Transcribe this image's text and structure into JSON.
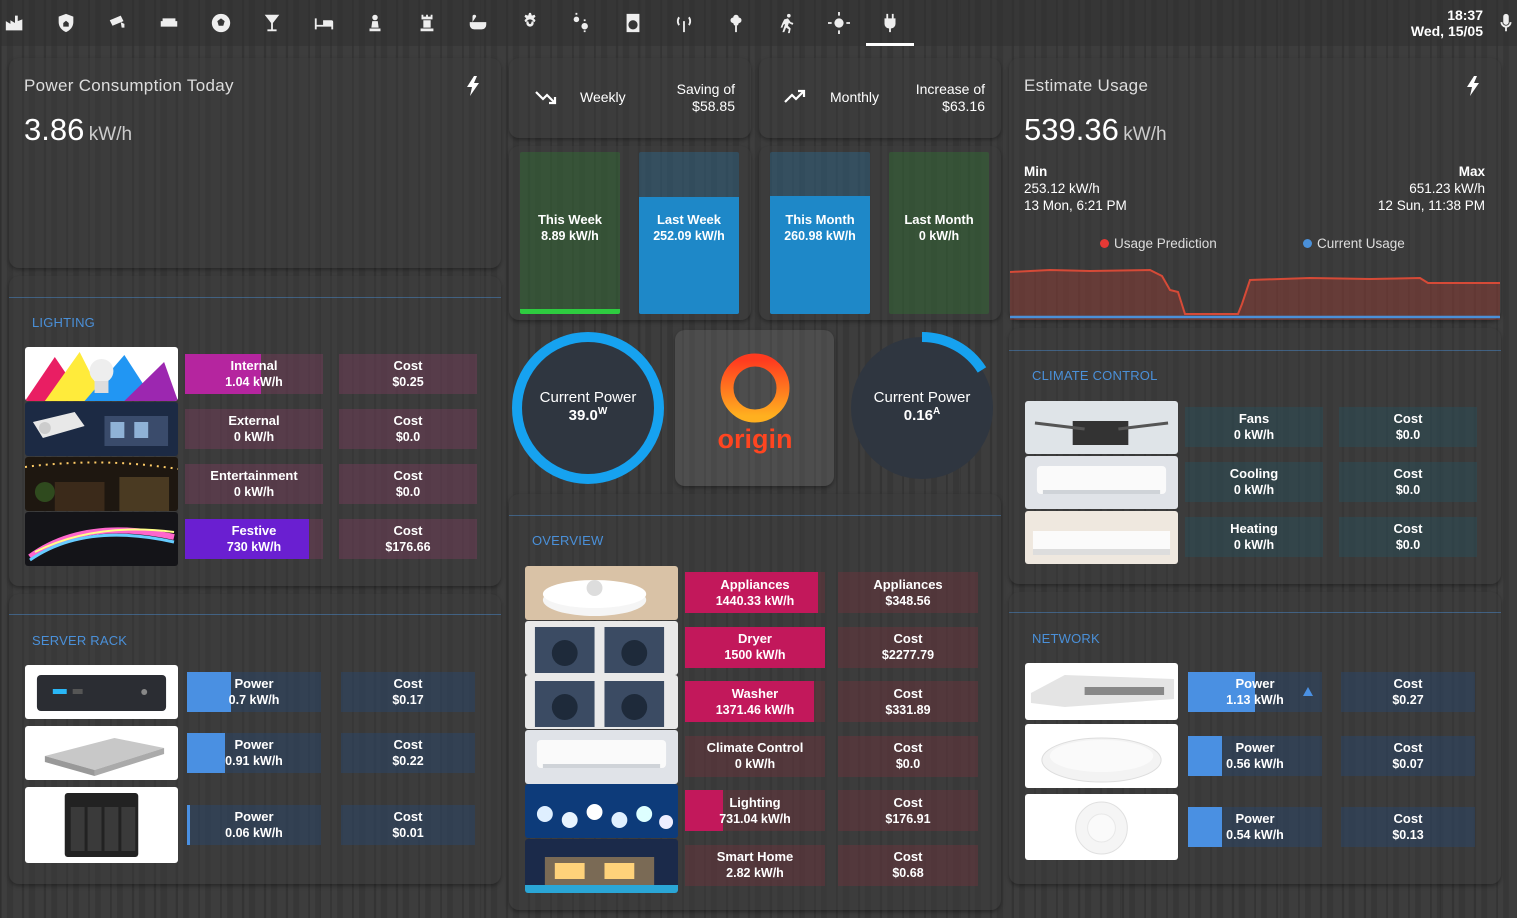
{
  "clock": {
    "time": "18:37",
    "date": "Wed, 15/05"
  },
  "nav": [
    "factory-icon",
    "shield-home-icon",
    "cctv-icon",
    "sofa-icon",
    "soccer-icon",
    "glass-cocktail-icon",
    "bed-icon",
    "chess-pawn-icon",
    "chess-rook-icon",
    "bathtub-icon",
    "gear-icon",
    "gears-icon",
    "washing-machine-icon",
    "antenna-icon",
    "flower-icon",
    "run-icon",
    "sun-icon",
    "power-plug-icon",
    "microphone-icon"
  ],
  "power_today": {
    "title": "Power Consumption Today",
    "value": "3.86",
    "unit": "kW/h"
  },
  "weekly": {
    "label": "Weekly",
    "line1": "Saving of",
    "line2": "$58.85"
  },
  "monthly": {
    "label": "Monthly",
    "line1": "Increase of",
    "line2": "$63.16"
  },
  "bars": [
    {
      "label": "This Week",
      "value": "8.89 kW/h",
      "fill": 0.03,
      "color": "#2e7d32"
    },
    {
      "label": "Last Week",
      "value": "252.09 kW/h",
      "fill": 0.72,
      "color": "#1e88c8"
    },
    {
      "label": "This Month",
      "value": "260.98 kW/h",
      "fill": 0.73,
      "color": "#1e88c8"
    },
    {
      "label": "Last Month",
      "value": "0 kW/h",
      "fill": 0,
      "color": "#2e7d32"
    }
  ],
  "estimate": {
    "title": "Estimate Usage",
    "value": "539.36",
    "unit": "kW/h",
    "min_label": "Min",
    "min_value": "253.12 kW/h",
    "min_time": "13 Mon, 6:21 PM",
    "max_label": "Max",
    "max_value": "651.23 kW/h",
    "max_time": "12 Sun, 11:38 PM",
    "legend1": "Usage Prediction",
    "legend2": "Current Usage"
  },
  "gauge_power": {
    "title": "Current Power",
    "value": "39.0",
    "sup": "W",
    "fill": 1.0
  },
  "gauge_current": {
    "title": "Current Power",
    "value": "0.16",
    "sup": "A",
    "fill": 0.16
  },
  "logo_text": "origin",
  "lighting": {
    "header": "LIGHTING",
    "rows": [
      {
        "name": "Internal",
        "value": "1.04 kW/h",
        "cost_label": "Cost",
        "cost": "$0.25"
      },
      {
        "name": "External",
        "value": "0 kW/h",
        "cost_label": "Cost",
        "cost": "$0.0"
      },
      {
        "name": "Entertainment",
        "value": "0 kW/h",
        "cost_label": "Cost",
        "cost": "$0.0"
      },
      {
        "name": "Festive",
        "value": "730 kW/h",
        "cost_label": "Cost",
        "cost": "$176.66"
      }
    ]
  },
  "server": {
    "header": "SERVER RACK",
    "rows": [
      {
        "name": "Power",
        "value": "0.7 kW/h",
        "cost_label": "Cost",
        "cost": "$0.17"
      },
      {
        "name": "Power",
        "value": "0.91 kW/h",
        "cost_label": "Cost",
        "cost": "$0.22"
      },
      {
        "name": "Power",
        "value": "0.06 kW/h",
        "cost_label": "Cost",
        "cost": "$0.01"
      }
    ]
  },
  "overview": {
    "header": "OVERVIEW",
    "rows": [
      {
        "name": "Appliances",
        "value": "1440.33 kW/h",
        "cost_label": "Appliances",
        "cost": "$348.56"
      },
      {
        "name": "Dryer",
        "value": "1500 kW/h",
        "cost_label": "Cost",
        "cost": "$2277.79"
      },
      {
        "name": "Washer",
        "value": "1371.46 kW/h",
        "cost_label": "Cost",
        "cost": "$331.89"
      },
      {
        "name": "Climate Control",
        "value": "0 kW/h",
        "cost_label": "Cost",
        "cost": "$0.0"
      },
      {
        "name": "Lighting",
        "value": "731.04 kW/h",
        "cost_label": "Cost",
        "cost": "$176.91"
      },
      {
        "name": "Smart Home",
        "value": "2.82 kW/h",
        "cost_label": "Cost",
        "cost": "$0.68"
      }
    ]
  },
  "climate": {
    "header": "CLIMATE CONTROL",
    "rows": [
      {
        "name": "Fans",
        "value": "0 kW/h",
        "cost_label": "Cost",
        "cost": "$0.0"
      },
      {
        "name": "Cooling",
        "value": "0 kW/h",
        "cost_label": "Cost",
        "cost": "$0.0"
      },
      {
        "name": "Heating",
        "value": "0 kW/h",
        "cost_label": "Cost",
        "cost": "$0.0"
      }
    ]
  },
  "network": {
    "header": "NETWORK",
    "rows": [
      {
        "name": "Power",
        "value": "1.13 kW/h",
        "cost_label": "Cost",
        "cost": "$0.27"
      },
      {
        "name": "Power",
        "value": "0.56 kW/h",
        "cost_label": "Cost",
        "cost": "$0.07"
      },
      {
        "name": "Power",
        "value": "0.54 kW/h",
        "cost_label": "Cost",
        "cost": "$0.13"
      }
    ]
  }
}
